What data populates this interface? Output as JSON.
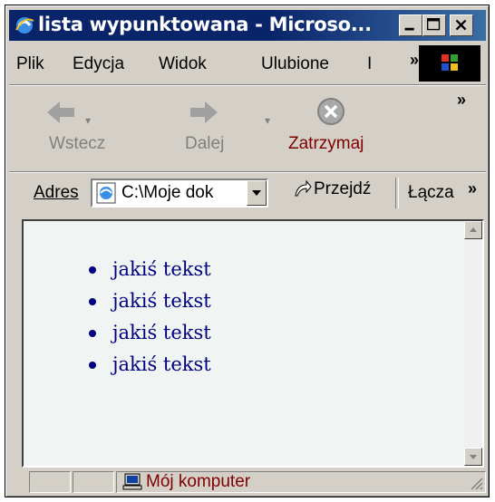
{
  "window": {
    "title": "lista wypunktowana - Microso...",
    "controls": [
      "minimize",
      "maximize",
      "close"
    ]
  },
  "menu": {
    "items": [
      {
        "label": "Plik",
        "accel": "P"
      },
      {
        "label": "Edycja",
        "accel": "E"
      },
      {
        "label": "Widok",
        "accel": "W"
      },
      {
        "label": "Ulubione",
        "accel": "U"
      },
      {
        "label": "I",
        "accel": ""
      }
    ],
    "more": "»"
  },
  "toolbar": {
    "back_label": "Wstecz",
    "forward_label": "Dalej",
    "stop_label": "Zatrzymaj",
    "more": "»"
  },
  "address": {
    "label": "Adres",
    "value": "C:\\Moje dok",
    "go_label": "Przejdź",
    "links_label": "Łącza",
    "links_more": "»"
  },
  "content": {
    "list_items": [
      "jakiś tekst",
      "jakiś tekst",
      "jakiś tekst",
      "jakiś tekst"
    ],
    "text_color": "#000080",
    "background": "#f0f4f2"
  },
  "status": {
    "zone_text": "Mój komputer"
  },
  "colors": {
    "title_bar": "#0a246a",
    "chrome": "#d4d0c8"
  }
}
